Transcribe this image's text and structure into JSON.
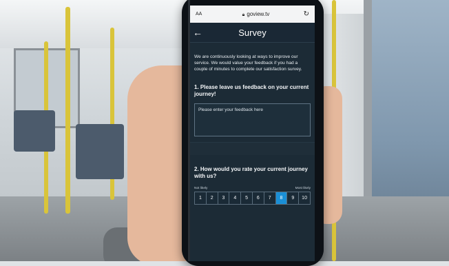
{
  "browser": {
    "text_size_label": "AA",
    "url": "goview.tv",
    "lock_icon": "lock-icon",
    "reload_icon": "reload-icon"
  },
  "header": {
    "back_icon": "back-arrow-icon",
    "title": "Survey"
  },
  "intro": {
    "text": "We are continuously looking at ways to improve our service. We would value your feedback if you had a couple of minutes to complete our satisfaction survey."
  },
  "question1": {
    "text": "1. Please leave us feedback on your current journey!",
    "placeholder": "Please enter your feedback here"
  },
  "question2": {
    "text": "2. How would you rate your current journey with us?",
    "low_label": "Not likely",
    "high_label": "Most likely",
    "options": [
      "1",
      "2",
      "3",
      "4",
      "5",
      "6",
      "7",
      "8",
      "9",
      "10"
    ],
    "selected": "8"
  },
  "colors": {
    "screen_background": "#1c2b36",
    "selected_accent": "#1a8fd6"
  }
}
